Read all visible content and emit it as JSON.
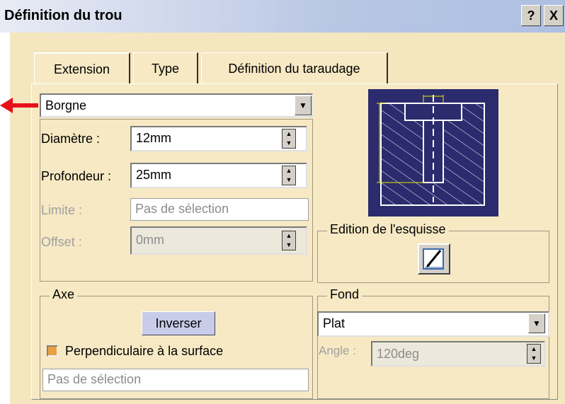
{
  "window": {
    "title": "Définition du trou",
    "help_label": "?",
    "close_label": "X"
  },
  "tabs": [
    {
      "label": "Extension"
    },
    {
      "label": "Type"
    },
    {
      "label": "Définition du taraudage"
    }
  ],
  "extension": {
    "type_select": {
      "value": "Borgne"
    },
    "diameter": {
      "label": "Diamètre :",
      "value": "12mm"
    },
    "depth": {
      "label": "Profondeur :",
      "value": "25mm"
    },
    "limit": {
      "label": "Limite :",
      "value": "Pas de sélection"
    },
    "offset": {
      "label": "Offset :",
      "value": "0mm"
    }
  },
  "sketch": {
    "group_label": "Edition de l'esquisse"
  },
  "axis": {
    "group_label": "Axe",
    "reverse_label": "Inverser",
    "perpendicular_label": "Perpendiculaire à la surface",
    "perpendicular_checked": true,
    "selection_value": "Pas de sélection"
  },
  "bottom": {
    "group_label": "Fond",
    "select_value": "Plat",
    "angle_label": "Angle :",
    "angle_value": "120deg"
  },
  "colors": {
    "title_bar": "#aec0e2",
    "dialog_bg": "#f4e6be",
    "diagram_bg": "#2b2b6e",
    "arrow": "#e8101a"
  }
}
